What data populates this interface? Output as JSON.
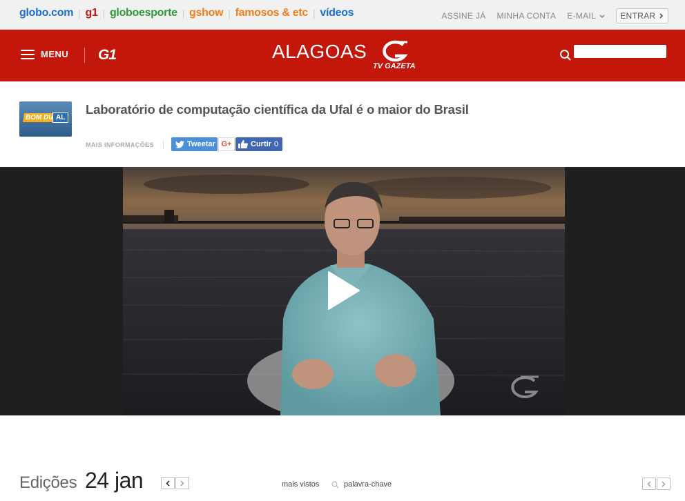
{
  "topbar": {
    "brands": [
      {
        "label": "globo.com",
        "color": "#1a6fcf"
      },
      {
        "label": "g1",
        "color": "#c4170c"
      },
      {
        "label": "globoesporte",
        "color": "#2f9a3b"
      },
      {
        "label": "gshow",
        "color": "#f07f1a"
      },
      {
        "label": "famosos & etc",
        "color": "#f07f1a"
      },
      {
        "label": "vídeos",
        "color": "#1a6fcf"
      }
    ],
    "assine": "ASSINE JÁ",
    "conta": "MINHA CONTA",
    "email": "E-MAIL",
    "entrar": "ENTRAR"
  },
  "header": {
    "menu_label": "MENU",
    "g1_logo": "G1",
    "region": "ALAGOAS",
    "gazeta_logo_text": "TV GAZETA",
    "search_placeholder": "",
    "accent": "#c4170c"
  },
  "article": {
    "program_logo": [
      "BOM DIA",
      "AL"
    ],
    "title": "Laboratório de computação científica da Ufal é o maior do Brasil",
    "more_info": "MAIS INFORMAÇÕES",
    "tweet": "Tweetar",
    "gplus": "G+",
    "curtir": "Curtir",
    "curtir_count": "0"
  },
  "video": {
    "play_icon": "play-icon",
    "watermark_icon": "tv-gazeta-watermark-icon"
  },
  "editions": {
    "label": "Edições",
    "date": "24 jan",
    "mais_vistos": "mais vistos",
    "keyword": "palavra-chave"
  }
}
